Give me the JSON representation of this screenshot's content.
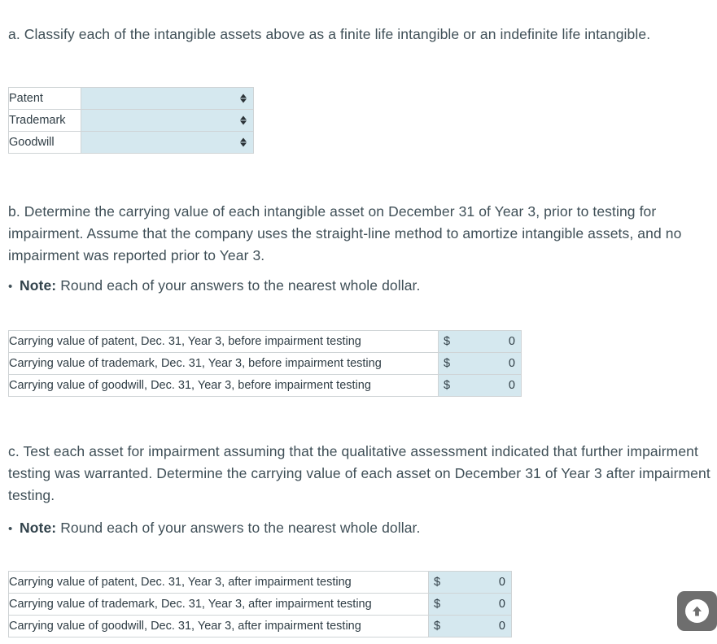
{
  "question": {
    "part_a": {
      "text": "a. Classify each of the intangible assets above as a finite life intangible or an indefinite life intangible.",
      "table": {
        "rows": [
          {
            "label": "Patent",
            "value": "",
            "control": "select"
          },
          {
            "label": "Trademark",
            "value": "",
            "control": "select"
          },
          {
            "label": "Goodwill",
            "value": "",
            "control": "select"
          }
        ]
      }
    },
    "part_b": {
      "text": "b. Determine the carrying value of each intangible asset on December 31 of Year 3, prior to testing for impairment. Assume that the company uses the straight-line method to amortize intangible assets, and no impairment was reported prior to Year 3.",
      "note_bullet": "•",
      "note_label": "Note:",
      "note_text": "Round each of your answers to the nearest whole dollar.",
      "table": {
        "rows": [
          {
            "label": "Carrying value of patent, Dec. 31, Year 3, before impairment testing",
            "currency": "$",
            "value": "0"
          },
          {
            "label": "Carrying value of trademark, Dec. 31, Year 3, before impairment testing",
            "currency": "$",
            "value": "0"
          },
          {
            "label": "Carrying value of goodwill, Dec. 31, Year 3, before impairment testing",
            "currency": "$",
            "value": "0"
          }
        ]
      }
    },
    "part_c": {
      "text": "c. Test each asset for impairment assuming that the qualitative assessment indicated that further impairment testing was warranted. Determine the carrying value of each asset on December 31 of Year 3 after impairment testing.",
      "note_bullet": "•",
      "note_label": "Note:",
      "note_text": "Round each of your answers to the nearest whole dollar.",
      "table": {
        "rows": [
          {
            "label": "Carrying value of patent, Dec. 31, Year 3, after impairment testing",
            "currency": "$",
            "value": "0"
          },
          {
            "label": "Carrying value of trademark, Dec. 31, Year 3, after impairment testing",
            "currency": "$",
            "value": "0"
          },
          {
            "label": "Carrying value of goodwill, Dec. 31, Year 3, after impairment testing",
            "currency": "$",
            "value": "0"
          }
        ]
      }
    }
  },
  "controls": {
    "scroll_top_icon": "arrow-up-circle-icon"
  },
  "colors": {
    "input_fill": "#d5e8ef",
    "border": "#cfd4d6",
    "text": "#3f4f57",
    "scroll_button": "#6e6e6e"
  }
}
